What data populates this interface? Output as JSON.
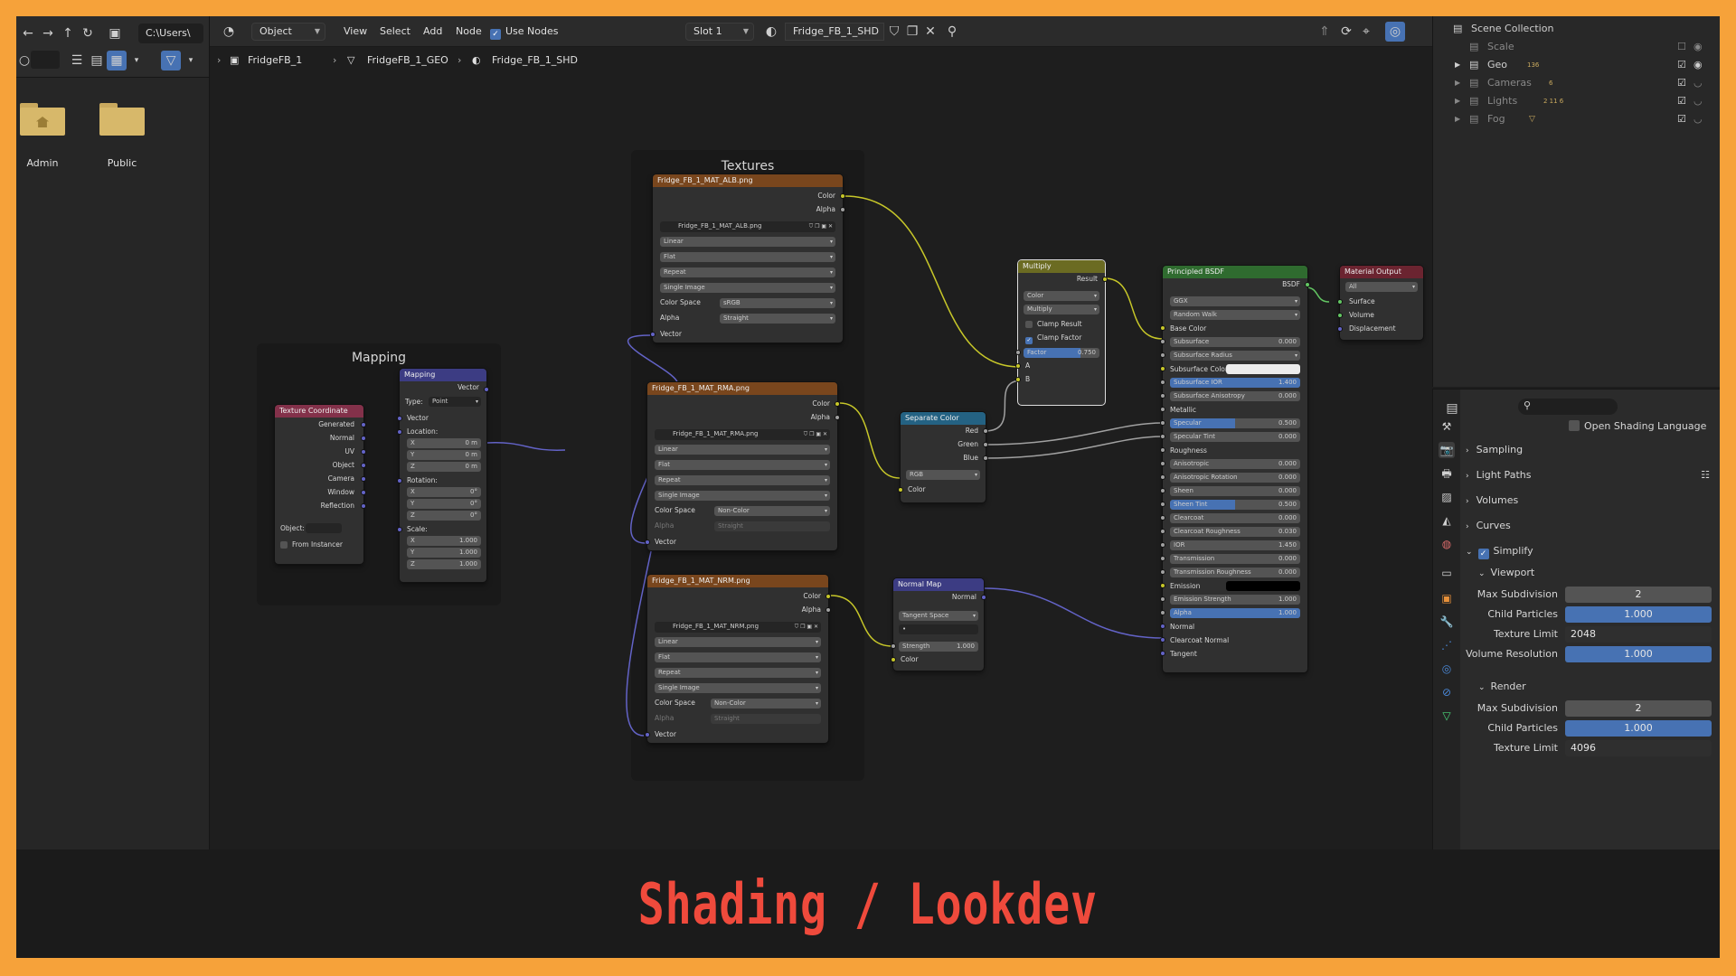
{
  "file_browser": {
    "path": "C:\\Users\\",
    "folders": [
      {
        "label": "Admin"
      },
      {
        "label": "Public"
      }
    ]
  },
  "header": {
    "mode": "Object",
    "menus": [
      "View",
      "Select",
      "Add",
      "Node"
    ],
    "use_nodes_label": "Use Nodes",
    "slot": "Slot 1",
    "material": "Fridge_FB_1_SHD"
  },
  "breadcrumb": [
    "FridgeFB_1",
    "FridgeFB_1_GEO",
    "Fridge_FB_1_SHD"
  ],
  "frames": {
    "textures": "Textures",
    "mapping": "Mapping"
  },
  "nodes": {
    "texcoord": {
      "title": "Texture Coordinate",
      "outputs": [
        "Generated",
        "Normal",
        "UV",
        "Object",
        "Camera",
        "Window",
        "Reflection"
      ],
      "object_label": "Object:",
      "from_instancer": "From Instancer"
    },
    "mapping": {
      "title": "Mapping",
      "output": "Vector",
      "type_label": "Type:",
      "type_value": "Point",
      "vector": "Vector",
      "location": "Location:",
      "rotation": "Rotation:",
      "scale": "Scale:",
      "loc": [
        {
          "axis": "X",
          "value": "0 m"
        },
        {
          "axis": "Y",
          "value": "0 m"
        },
        {
          "axis": "Z",
          "value": "0 m"
        }
      ],
      "rot": [
        {
          "axis": "X",
          "value": "0°"
        },
        {
          "axis": "Y",
          "value": "0°"
        },
        {
          "axis": "Z",
          "value": "0°"
        }
      ],
      "scl": [
        {
          "axis": "X",
          "value": "1.000"
        },
        {
          "axis": "Y",
          "value": "1.000"
        },
        {
          "axis": "Z",
          "value": "1.000"
        }
      ]
    },
    "tex_alb": {
      "title": "Fridge_FB_1_MAT_ALB.png",
      "image": "Fridge_FB_1_MAT_ALB.png",
      "color_space": "sRGB",
      "alpha": "Straight"
    },
    "tex_rma": {
      "title": "Fridge_FB_1_MAT_RMA.png",
      "image": "Fridge_FB_1_MAT_RMA.png",
      "color_space": "Non-Color",
      "alpha": "Straight"
    },
    "tex_nrm": {
      "title": "Fridge_FB_1_MAT_NRM.png",
      "image": "Fridge_FB_1_MAT_NRM.png",
      "color_space": "Non-Color",
      "alpha": "Straight"
    },
    "tex_common": {
      "out_color": "Color",
      "out_alpha": "Alpha",
      "interp": "Linear",
      "proj": "Flat",
      "ext": "Repeat",
      "source": "Single Image",
      "cs_label": "Color Space",
      "alpha_label": "Alpha",
      "vector": "Vector"
    },
    "separate": {
      "title": "Separate Color",
      "outs": [
        "Red",
        "Green",
        "Blue"
      ],
      "mode": "RGB",
      "input": "Color"
    },
    "normalmap": {
      "title": "Normal Map",
      "out": "Normal",
      "space": "Tangent Space",
      "strength_label": "Strength",
      "strength": "1.000",
      "input": "Color"
    },
    "multiply": {
      "title": "Multiply",
      "out": "Result",
      "dtype": "Color",
      "blend": "Multiply",
      "clamp_result": "Clamp Result",
      "clamp_factor": "Clamp Factor",
      "factor_label": "Factor",
      "factor": "0.750",
      "a": "A",
      "b": "B"
    },
    "bsdf": {
      "title": "Principled BSDF",
      "out": "BSDF",
      "dist": "GGX",
      "sss": "Random Walk",
      "rows": [
        {
          "label": "Base Color",
          "type": "plain"
        },
        {
          "label": "Subsurface",
          "value": "0.000"
        },
        {
          "label": "Subsurface Radius",
          "type": "drop"
        },
        {
          "label": "Subsurface Color",
          "type": "color"
        },
        {
          "label": "Subsurface IOR",
          "value": "1.400",
          "fill": 1
        },
        {
          "label": "Subsurface Anisotropy",
          "value": "0.000"
        },
        {
          "label": "Metallic",
          "type": "plain"
        },
        {
          "label": "Specular",
          "value": "0.500",
          "fill": 0.5
        },
        {
          "label": "Specular Tint",
          "value": "0.000"
        },
        {
          "label": "Roughness",
          "type": "plain"
        },
        {
          "label": "Anisotropic",
          "value": "0.000"
        },
        {
          "label": "Anisotropic Rotation",
          "value": "0.000"
        },
        {
          "label": "Sheen",
          "value": "0.000"
        },
        {
          "label": "Sheen Tint",
          "value": "0.500",
          "fill": 0.5
        },
        {
          "label": "Clearcoat",
          "value": "0.000"
        },
        {
          "label": "Clearcoat Roughness",
          "value": "0.030"
        },
        {
          "label": "IOR",
          "value": "1.450"
        },
        {
          "label": "Transmission",
          "value": "0.000"
        },
        {
          "label": "Transmission Roughness",
          "value": "0.000"
        },
        {
          "label": "Emission",
          "type": "black"
        },
        {
          "label": "Emission Strength",
          "value": "1.000"
        },
        {
          "label": "Alpha",
          "value": "1.000",
          "fill": 1
        },
        {
          "label": "Normal",
          "type": "plain"
        },
        {
          "label": "Clearcoat Normal",
          "type": "plain"
        },
        {
          "label": "Tangent",
          "type": "plain"
        }
      ]
    },
    "output": {
      "title": "Material Output",
      "target": "All",
      "inputs": [
        "Surface",
        "Volume",
        "Displacement"
      ]
    }
  },
  "outliner": {
    "title": "Scene Collection",
    "rows": [
      {
        "label": "Scale",
        "badges": ""
      },
      {
        "label": "Geo",
        "badges": "136"
      },
      {
        "label": "Cameras",
        "badges": "6"
      },
      {
        "label": "Lights",
        "badges": "2  11  6"
      },
      {
        "label": "Fog",
        "badges": ""
      }
    ]
  },
  "properties": {
    "open_shading_language": "Open Shading Language",
    "panels": [
      "Sampling",
      "Light Paths",
      "Volumes",
      "Curves"
    ],
    "simplify": "Simplify",
    "viewport": "Viewport",
    "render": "Render",
    "viewport_fields": [
      {
        "label": "Max Subdivision",
        "value": "2",
        "kind": "grey"
      },
      {
        "label": "Child Particles",
        "value": "1.000",
        "kind": "blue"
      },
      {
        "label": "Texture Limit",
        "value": "2048",
        "kind": "dark"
      },
      {
        "label": "Volume Resolution",
        "value": "1.000",
        "kind": "blue"
      }
    ],
    "render_fields": [
      {
        "label": "Max Subdivision",
        "value": "2",
        "kind": "grey"
      },
      {
        "label": "Child Particles",
        "value": "1.000",
        "kind": "blue"
      },
      {
        "label": "Texture Limit",
        "value": "4096",
        "kind": "dark"
      }
    ]
  },
  "banner": "Shading / Lookdev"
}
